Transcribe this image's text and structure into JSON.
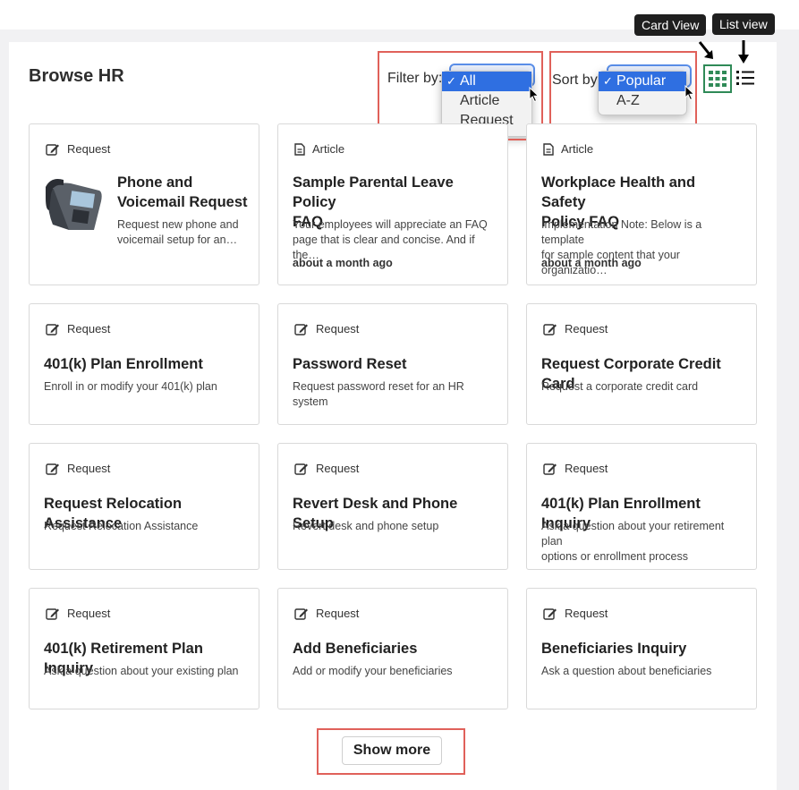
{
  "page_title": "Browse HR",
  "filter": {
    "label": "Filter by:",
    "options": [
      "All",
      "Article",
      "Request"
    ],
    "selected": "All"
  },
  "sort": {
    "label": "Sort by:",
    "options": [
      "Popular",
      "A-Z"
    ],
    "selected": "Popular"
  },
  "checkmark": "✓",
  "tooltips": {
    "card_view": "Card View",
    "list_view": "List view"
  },
  "cards": [
    {
      "type": "Request",
      "title": "Phone and Voicemail Request",
      "title_line1": "Phone and",
      "title_line2": "Voicemail Request",
      "desc_line1": "Request new phone and",
      "desc_line2": "voicemail setup for an…"
    },
    {
      "type": "Article",
      "title_line1": "Sample Parental Leave Policy",
      "title_line2": "FAQ",
      "desc_line1": "Your employees will appreciate an FAQ",
      "desc_line2": "page that is clear and concise. And if the…",
      "date": "about a month ago"
    },
    {
      "type": "Article",
      "title_line1": "Workplace Health and Safety",
      "title_line2": "Policy FAQ",
      "desc_line1": "Implementation Note: Below is a template",
      "desc_line2": "for sample content that your organizatio…",
      "date": "about a month ago"
    },
    {
      "type": "Request",
      "title": "401(k) Plan Enrollment",
      "desc": "Enroll in or modify your 401(k) plan"
    },
    {
      "type": "Request",
      "title": "Password Reset",
      "desc": "Request password reset for an HR system"
    },
    {
      "type": "Request",
      "title": "Request Corporate Credit Card",
      "desc": "Request a corporate credit card"
    },
    {
      "type": "Request",
      "title": "Request Relocation Assistance",
      "desc": "Request Relocation Assistance"
    },
    {
      "type": "Request",
      "title": "Revert Desk and Phone Setup",
      "desc": "Revert desk and phone setup"
    },
    {
      "type": "Request",
      "title": "401(k) Plan Enrollment Inquiry",
      "desc_line1": "Ask a question about your retirement plan",
      "desc_line2": "options or enrollment process"
    },
    {
      "type": "Request",
      "title": "401(k) Retirement Plan Inquiry",
      "desc": "Ask a question about your existing plan"
    },
    {
      "type": "Request",
      "title": "Add Beneficiaries",
      "desc": "Add or modify your beneficiaries"
    },
    {
      "type": "Request",
      "title": "Beneficiaries Inquiry",
      "desc": "Ask a question about beneficiaries"
    }
  ],
  "show_more": "Show more",
  "colors": {
    "accent_blue": "#2f6fe1",
    "highlight_red": "#e0615a",
    "grid_green": "#2f8a57"
  }
}
